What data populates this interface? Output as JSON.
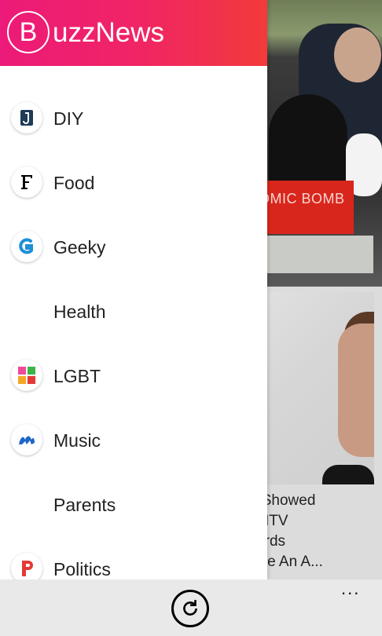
{
  "app": {
    "logo_letter": "B",
    "title_rest": "uzzNews"
  },
  "background": {
    "banner_text": "OMIC BOMB",
    "article_lines": [
      "ratt Showed",
      "he MTV",
      "Awards",
      "g Like An A..."
    ]
  },
  "drawer": {
    "items": [
      {
        "label": "DIY",
        "icon": "diy-icon"
      },
      {
        "label": "Food",
        "icon": "food-icon"
      },
      {
        "label": "Geeky",
        "icon": "geeky-icon"
      },
      {
        "label": "Health",
        "icon": ""
      },
      {
        "label": "LGBT",
        "icon": "lgbt-icon"
      },
      {
        "label": "Music",
        "icon": "music-icon"
      },
      {
        "label": "Parents",
        "icon": ""
      },
      {
        "label": "Politics",
        "icon": "politics-icon"
      }
    ]
  },
  "appbar": {
    "refresh_icon": "refresh-icon",
    "more_label": "..."
  },
  "colors": {
    "header_start": "#ec1a78",
    "header_end": "#f23a3a",
    "banner": "#d9261c"
  }
}
